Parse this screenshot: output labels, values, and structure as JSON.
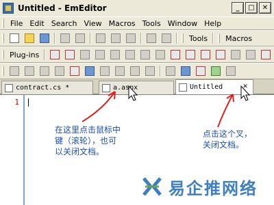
{
  "window": {
    "title": "Untitled - EmEditor",
    "min_glyph": "_",
    "max_glyph": "□",
    "close_glyph": "✕"
  },
  "menu": [
    "File",
    "Edit",
    "Search",
    "View",
    "Macros",
    "Tools",
    "Window",
    "Help"
  ],
  "toolbar2": {
    "tools_label": "Tools",
    "macros_label": "Macros"
  },
  "toolbar3": {
    "plugins_label": "Plug-ins"
  },
  "tabs": [
    {
      "label": "contract.cs *"
    },
    {
      "label": "a.aspx"
    },
    {
      "label": "Untitled"
    }
  ],
  "editor": {
    "line_number": "1"
  },
  "annotations": {
    "middle_click": "在这里点击鼠标中\n键（滚轮），也可\n以关闭文档。",
    "close_x": "点击这个叉，\n关闭文档。"
  },
  "logo": {
    "text": "易企推网络"
  },
  "colors": {
    "annotation": "#1d4fb3",
    "arrow": "#e02020",
    "logo": "#3d7fc1"
  }
}
